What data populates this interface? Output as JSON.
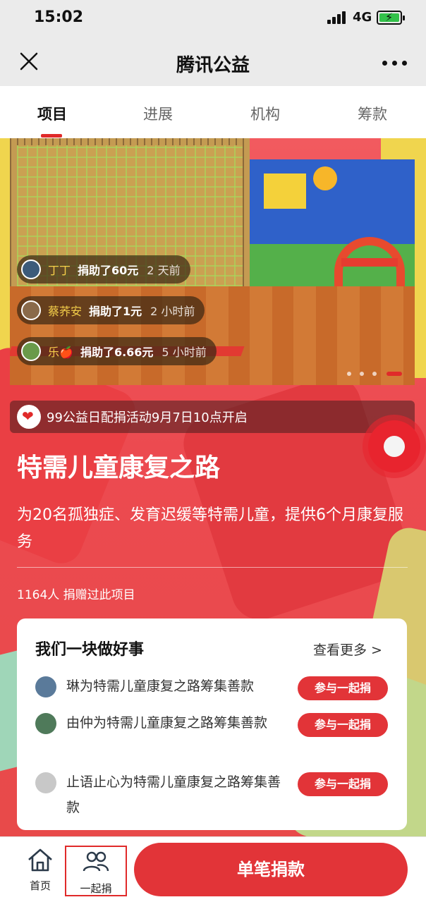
{
  "status_bar": {
    "time": "15:02",
    "network": "4G"
  },
  "navbar": {
    "title": "腾讯公益"
  },
  "tabs": [
    "项目",
    "进展",
    "机构",
    "筹款"
  ],
  "hero": {
    "feeds": [
      {
        "name": "丁丁",
        "action": "捐助了60元",
        "when": "2 天前"
      },
      {
        "name": "蔡荞安",
        "action": "捐助了1元",
        "when": "2 小时前"
      },
      {
        "name": "乐🍎",
        "action": "捐助了6.66元",
        "when": "5 小时前"
      }
    ]
  },
  "notice": "99公益日配捐活动9月7日10点开启",
  "project": {
    "title": "特需儿童康复之路",
    "description": "为20名孤独症、发育迟缓等特需儿童，提供6个月康复服务",
    "donors": "1164人 捐赠过此项目"
  },
  "together": {
    "title": "我们一块做好事",
    "more": "查看更多 >",
    "items": [
      {
        "text": "琳为特需儿童康复之路筹集善款",
        "button": "参与一起捐"
      },
      {
        "text": "由仲为特需儿童康复之路筹集善款",
        "button": "参与一起捐"
      },
      {
        "text": "止语止心为特需儿童康复之路筹集善款",
        "button": "参与一起捐"
      }
    ]
  },
  "bottom_bar": {
    "home": "首页",
    "together": "一起捐",
    "donate": "单笔捐款"
  },
  "colors": {
    "accent": "#e23438",
    "page_bg": "#ec4a50"
  }
}
